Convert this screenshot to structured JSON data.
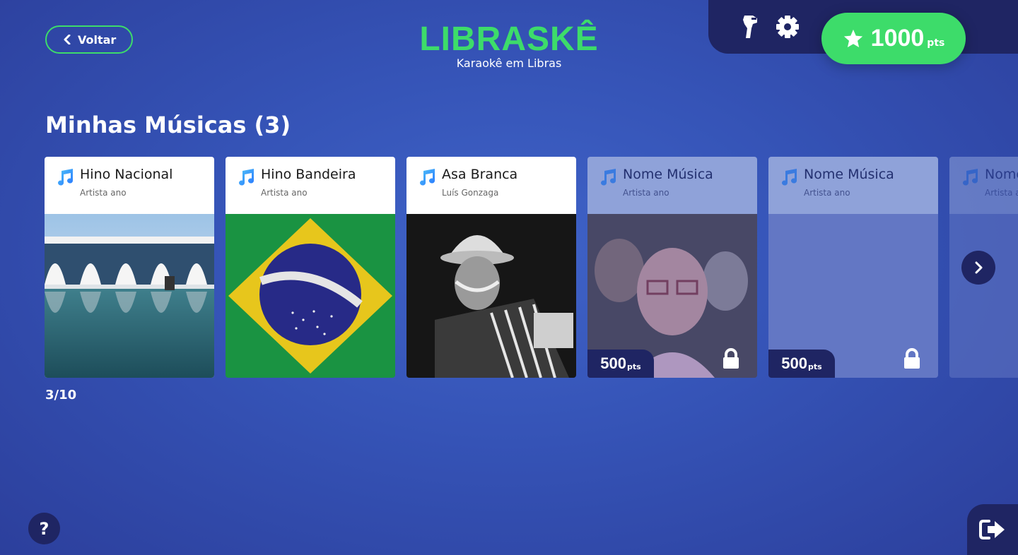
{
  "header": {
    "back_label": "Voltar",
    "brand": "LIBRASKÊ",
    "tagline": "Karaokê em Libras",
    "points_value": "1000",
    "points_unit": "pts"
  },
  "section": {
    "title": "Minhas Músicas (3)",
    "counter": "3/10"
  },
  "songs": [
    {
      "title": "Hino Nacional",
      "subtitle": "Artista ano",
      "locked": false,
      "image": "palace-photo"
    },
    {
      "title": "Hino Bandeira",
      "subtitle": "Artista ano",
      "locked": false,
      "image": "brazil-flag"
    },
    {
      "title": "Asa Branca",
      "subtitle": "Luís Gonzaga",
      "locked": false,
      "image": "accordion-player-photo"
    },
    {
      "title": "Nome Música",
      "subtitle": "Artista ano",
      "locked": true,
      "price": "500",
      "price_unit": "pts",
      "image": "band-photo"
    },
    {
      "title": "Nome Música",
      "subtitle": "Artista ano",
      "locked": true,
      "price": "500",
      "price_unit": "pts",
      "image": "placeholder"
    },
    {
      "title": "Nome Música",
      "subtitle": "Artista ano",
      "locked": true,
      "image": "placeholder"
    }
  ],
  "help_label": "?",
  "colors": {
    "accent_green": "#3ddc6a",
    "dark_navy": "#1f2563",
    "bg_blue": "#3a5bbf"
  },
  "icons": {
    "hand_icon": "libras-hand-icon",
    "settings": "gear-icon",
    "points": "star-icon",
    "exit": "logout-icon"
  }
}
